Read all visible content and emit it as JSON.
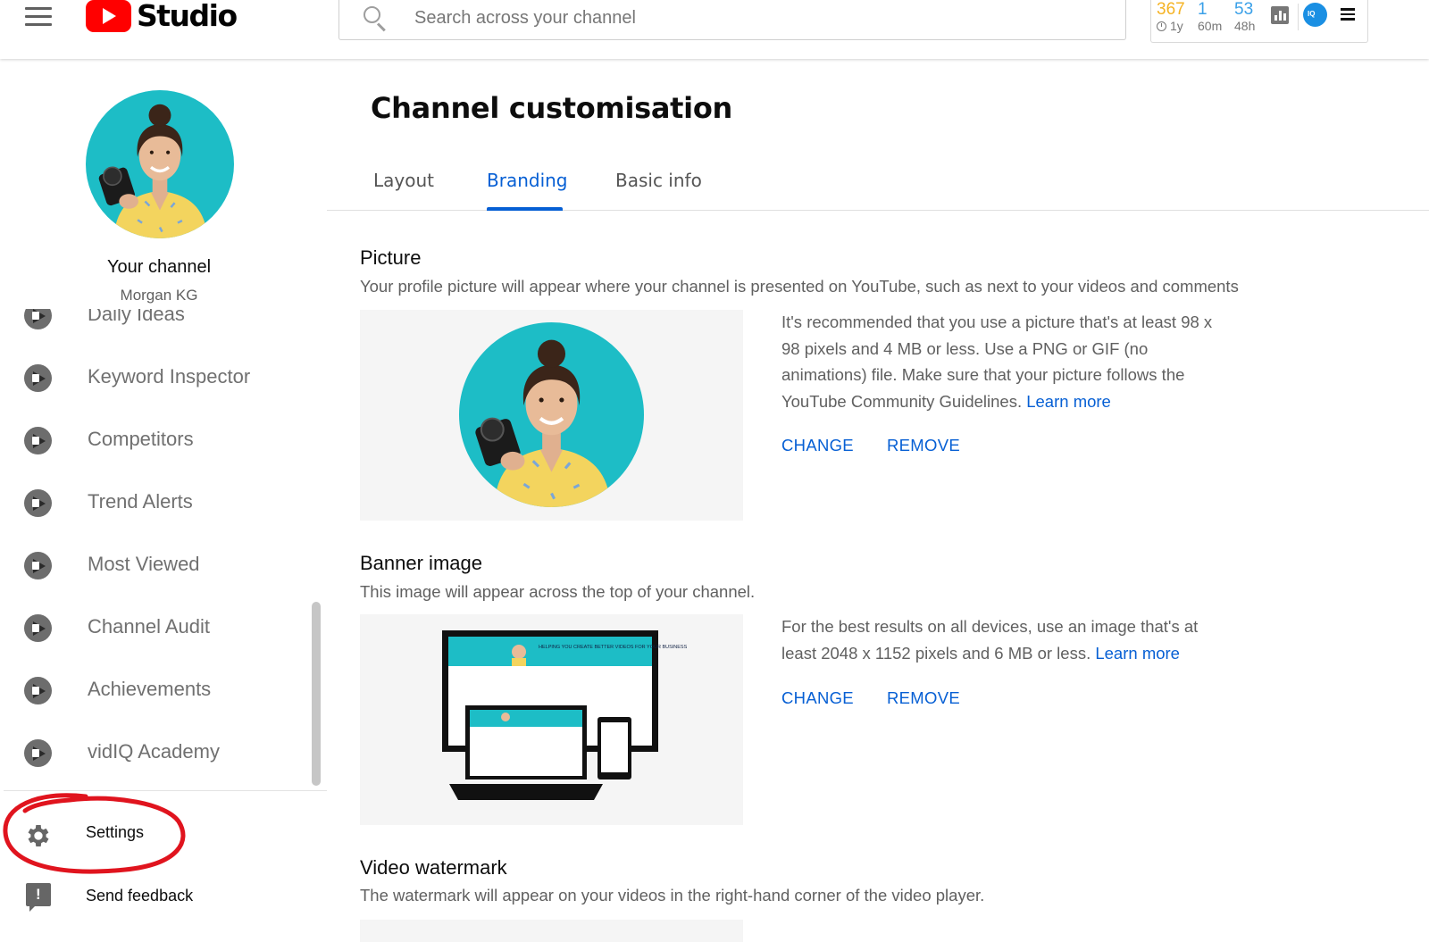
{
  "header": {
    "logo_text": "Studio",
    "search_placeholder": "Search across your channel",
    "stats": [
      {
        "value": "367",
        "label": "1y"
      },
      {
        "value": "1",
        "label": "60m"
      },
      {
        "value": "53",
        "label": "48h"
      }
    ]
  },
  "sidebar": {
    "your_channel": "Your channel",
    "channel_name": "Morgan KG",
    "items": [
      {
        "label": "Daily Ideas"
      },
      {
        "label": "Keyword Inspector"
      },
      {
        "label": "Competitors"
      },
      {
        "label": "Trend Alerts"
      },
      {
        "label": "Most Viewed"
      },
      {
        "label": "Channel Audit"
      },
      {
        "label": "Achievements"
      },
      {
        "label": "vidIQ Academy"
      }
    ],
    "settings_label": "Settings",
    "feedback_label": "Send feedback"
  },
  "main": {
    "title": "Channel customisation",
    "tabs": [
      {
        "label": "Layout",
        "active": false
      },
      {
        "label": "Branding",
        "active": true
      },
      {
        "label": "Basic info",
        "active": false
      }
    ],
    "picture": {
      "title": "Picture",
      "description": "Your profile picture will appear where your channel is presented on YouTube, such as next to your videos and comments",
      "info": "It's recommended that you use a picture that's at least 98 x 98 pixels and 4 MB or less. Use a PNG or GIF (no animations) file. Make sure that your picture follows the YouTube Community Guidelines.",
      "learn_more": "Learn more",
      "change": "CHANGE",
      "remove": "REMOVE"
    },
    "banner": {
      "title": "Banner image",
      "description": "This image will appear across the top of your channel.",
      "info": "For the best results on all devices, use an image that's at least 2048 x 1152 pixels and 6 MB or less.",
      "learn_more": "Learn more",
      "change": "CHANGE",
      "remove": "REMOVE",
      "banner_text": "HELPING YOU CREATE BETTER VIDEOS FOR YOUR BUSINESS"
    },
    "watermark": {
      "title": "Video watermark",
      "description": "The watermark will appear on your videos in the right-hand corner of the video player."
    }
  },
  "colors": {
    "accent": "#065fd4",
    "youtube_red": "#ff0000",
    "avatar_bg": "#16bcc4",
    "annotation": "#e0141e"
  }
}
